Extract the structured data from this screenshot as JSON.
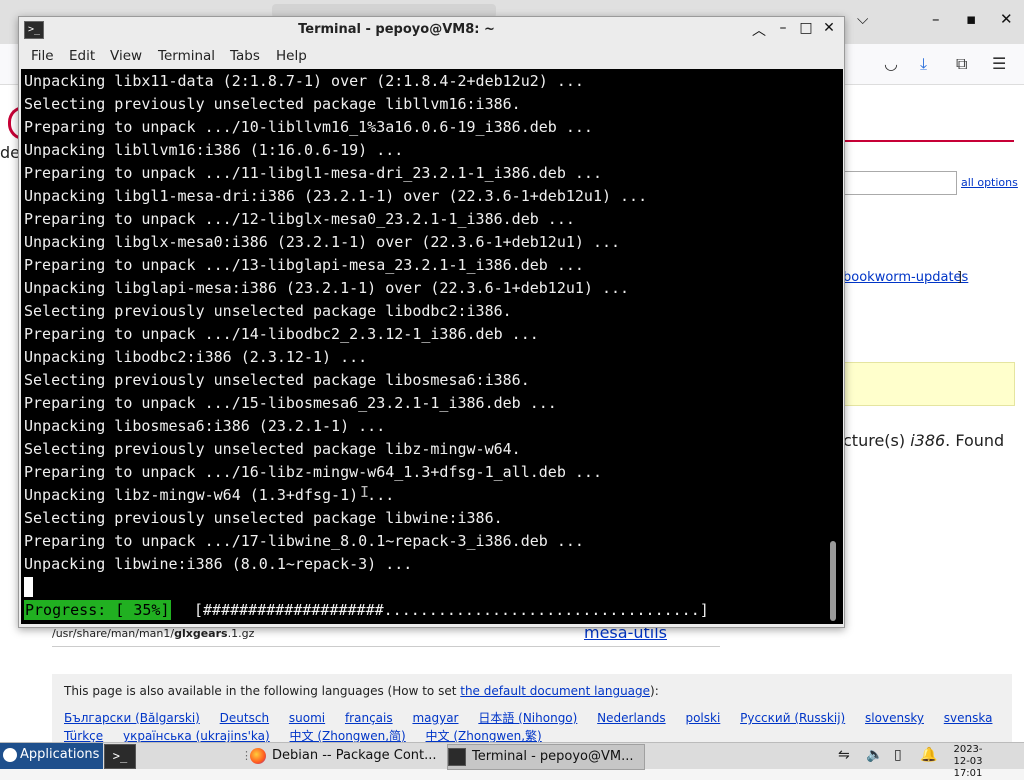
{
  "browser": {
    "all_options": "all options",
    "bookworm_link": "bookworm-updates",
    "bookworm_bracket": "]",
    "arch_prefix": "cture(s) ",
    "arch_value": "i386",
    "arch_suffix": ". Found",
    "deb_partial": "de",
    "file_path_prefix": "/usr/share/man/man1/",
    "file_path_name": "glxgears",
    "file_path_suffix": ".1.gz",
    "package_link": "mesa-utils",
    "lang_intro_prefix": "This page is also available in the following languages (How to set ",
    "lang_intro_link": "the default document language",
    "lang_intro_suffix": "):",
    "languages_row1": [
      "Български (Bălgarski)",
      "Deutsch",
      "suomi",
      "français",
      "magyar",
      "日本語 (Nihongo)",
      "Nederlands",
      "polski",
      "Русский (Russkij)",
      "slovensky",
      "svenska"
    ],
    "languages_row2": [
      "Türkçe",
      "українська (ukrajins'ka)",
      "中文 (Zhongwen,简)",
      "中文 (Zhongwen,繁)"
    ]
  },
  "terminal": {
    "title": "Terminal - pepoyo@VM8: ~",
    "menu": [
      "File",
      "Edit",
      "View",
      "Terminal",
      "Tabs",
      "Help"
    ],
    "lines": [
      "Unpacking libx11-data (2:1.8.7-1) over (2:1.8.4-2+deb12u2) ...",
      "Selecting previously unselected package libllvm16:i386.",
      "Preparing to unpack .../10-libllvm16_1%3a16.0.6-19_i386.deb ...",
      "Unpacking libllvm16:i386 (1:16.0.6-19) ...",
      "Preparing to unpack .../11-libgl1-mesa-dri_23.2.1-1_i386.deb ...",
      "Unpacking libgl1-mesa-dri:i386 (23.2.1-1) over (22.3.6-1+deb12u1) ...",
      "Preparing to unpack .../12-libglx-mesa0_23.2.1-1_i386.deb ...",
      "Unpacking libglx-mesa0:i386 (23.2.1-1) over (22.3.6-1+deb12u1) ...",
      "Preparing to unpack .../13-libglapi-mesa_23.2.1-1_i386.deb ...",
      "Unpacking libglapi-mesa:i386 (23.2.1-1) over (22.3.6-1+deb12u1) ...",
      "Selecting previously unselected package libodbc2:i386.",
      "Preparing to unpack .../14-libodbc2_2.3.12-1_i386.deb ...",
      "Unpacking libodbc2:i386 (2.3.12-1) ...",
      "Selecting previously unselected package libosmesa6:i386.",
      "Preparing to unpack .../15-libosmesa6_23.2.1-1_i386.deb ...",
      "Unpacking libosmesa6:i386 (23.2.1-1) ...",
      "Selecting previously unselected package libz-mingw-w64.",
      "Preparing to unpack .../16-libz-mingw-w64_1.3+dfsg-1_all.deb ...",
      "Unpacking libz-mingw-w64 (1.3+dfsg-1) ...",
      "Selecting previously unselected package libwine:i386.",
      "Preparing to unpack .../17-libwine_8.0.1~repack-3_i386.deb ...",
      "Unpacking libwine:i386 (8.0.1~repack-3) ..."
    ],
    "progress_label": "Progress: [ 35%]",
    "progress_bar": "[####################...................................]",
    "progress_percent": 35
  },
  "taskbar": {
    "applications": "Applications",
    "tasks": [
      "Debian -- Package Cont...",
      "Terminal - pepoyo@VM..."
    ],
    "clock_date": "2023-12-03",
    "clock_time": "17:01"
  }
}
